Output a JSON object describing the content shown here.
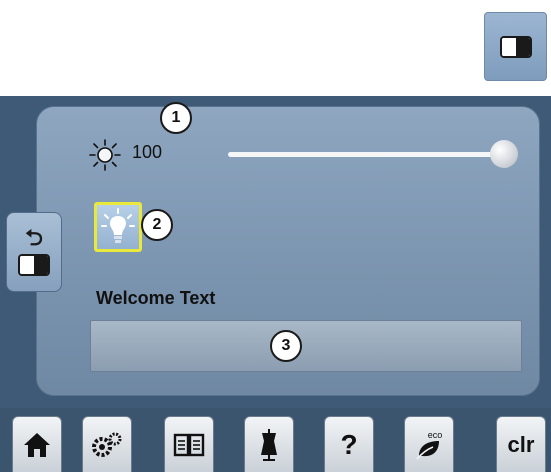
{
  "top_icon": {
    "name": "contrast-icon"
  },
  "side_button": {
    "back_icon": "back-arrow-icon",
    "contrast_icon": "contrast-icon"
  },
  "brightness": {
    "icon": "sun-icon",
    "value": "100",
    "slider_fraction": 1.0,
    "callout": "1"
  },
  "light_button": {
    "icon": "lightbulb-icon",
    "callout": "2"
  },
  "welcome": {
    "label": "Welcome Text",
    "value": "",
    "callout": "3"
  },
  "toolbar": {
    "items": [
      {
        "icon": "home-icon"
      },
      {
        "icon": "settings-icon"
      },
      {
        "icon": "manual-book-icon"
      },
      {
        "icon": "dress-form-icon"
      },
      {
        "icon": "help-icon",
        "label": "?"
      },
      {
        "icon": "eco-icon",
        "label": "eco"
      },
      {
        "icon": "clear-icon",
        "label": "clr"
      }
    ]
  },
  "colors": {
    "screen_bg": "#3f5a76",
    "panel_bg": "#8ea6c0",
    "highlight": "#e9e93b"
  }
}
